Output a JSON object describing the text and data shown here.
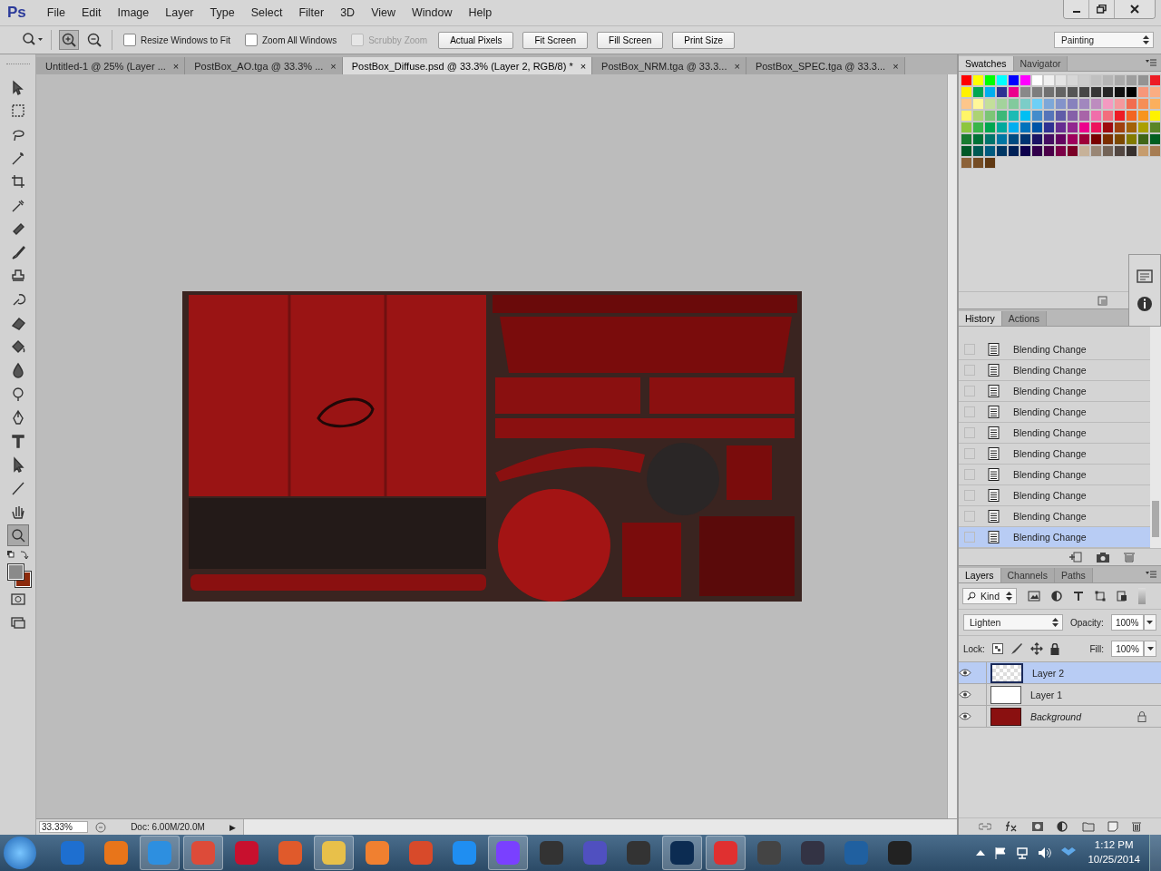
{
  "app": {
    "logo": "Ps"
  },
  "menu": [
    "File",
    "Edit",
    "Image",
    "Layer",
    "Type",
    "Select",
    "Filter",
    "3D",
    "View",
    "Window",
    "Help"
  ],
  "options": {
    "zoom_buttons": [
      {
        "kind": "in",
        "selected": true
      },
      {
        "kind": "out",
        "selected": false
      }
    ],
    "checkboxes": [
      {
        "label": "Resize Windows to Fit",
        "checked": false,
        "disabled": false
      },
      {
        "label": "Zoom All Windows",
        "checked": false,
        "disabled": false
      },
      {
        "label": "Scrubby Zoom",
        "checked": false,
        "disabled": true
      }
    ],
    "buttons": [
      "Actual Pixels",
      "Fit Screen",
      "Fill Screen",
      "Print Size"
    ],
    "workspace": "Painting"
  },
  "tabs": [
    {
      "label": "Untitled-1 @ 25% (Layer ...",
      "close": "×",
      "selected": false
    },
    {
      "label": "PostBox_AO.tga @ 33.3% ...",
      "close": "×",
      "selected": false
    },
    {
      "label": "PostBox_Diffuse.psd @ 33.3% (Layer 2, RGB/8) *",
      "close": "×",
      "selected": true
    },
    {
      "label": "PostBox_NRM.tga @ 33.3...",
      "close": "×",
      "selected": false
    },
    {
      "label": "PostBox_SPEC.tga @ 33.3...",
      "close": "×",
      "selected": false
    }
  ],
  "tools": [
    {
      "kind": "move",
      "selected": false
    },
    {
      "kind": "marquee",
      "selected": false
    },
    {
      "kind": "lasso",
      "selected": false
    },
    {
      "kind": "wand",
      "selected": false
    },
    {
      "kind": "crop",
      "selected": false
    },
    {
      "kind": "eyedropper",
      "selected": false
    },
    {
      "kind": "heal",
      "selected": false
    },
    {
      "kind": "brush",
      "selected": false
    },
    {
      "kind": "stamp",
      "selected": false
    },
    {
      "kind": "history",
      "selected": false
    },
    {
      "kind": "eraser",
      "selected": false
    },
    {
      "kind": "bucket",
      "selected": false
    },
    {
      "kind": "blur",
      "selected": false
    },
    {
      "kind": "dodge",
      "selected": false
    },
    {
      "kind": "pen",
      "selected": false
    },
    {
      "kind": "type",
      "selected": false
    },
    {
      "kind": "select",
      "selected": false
    },
    {
      "kind": "line",
      "selected": false
    },
    {
      "kind": "hand",
      "selected": false
    },
    {
      "kind": "zoom",
      "selected": true
    }
  ],
  "colors": [
    {
      "kind": "foreground",
      "color": "#8a8a8a"
    },
    {
      "kind": "background",
      "color": "#8c2a0c"
    }
  ],
  "status": {
    "zoom": "33.33%",
    "doc": "Doc: 6.00M/20.0M",
    "arrow": "▶"
  },
  "swatches_panel": {
    "tabs": [
      {
        "label": "Swatches",
        "selected": true
      },
      {
        "label": "Navigator",
        "selected": false
      }
    ],
    "rows": [
      [
        {
          "color": "#ff0000"
        },
        {
          "color": "#ffff00"
        },
        {
          "color": "#00ff00"
        },
        {
          "color": "#00ffff"
        },
        {
          "color": "#0000ff"
        },
        {
          "color": "#ff00ff"
        },
        {
          "color": "#ffffff"
        },
        {
          "color": "#f0f0f0"
        },
        {
          "color": "#e3e3e3"
        },
        {
          "color": "#d6d6d6"
        },
        {
          "color": "#cccccc"
        },
        {
          "color": "#c0c0c0"
        },
        {
          "color": "#b5b5b5"
        },
        {
          "color": "#a9a9a9"
        },
        {
          "color": "#9e9e9e"
        },
        {
          "color": "#939393"
        },
        {
          "color": "#ed1c24"
        }
      ],
      [
        {
          "color": "#fff200"
        },
        {
          "color": "#00a651"
        },
        {
          "color": "#00aeef"
        },
        {
          "color": "#2e3192"
        },
        {
          "color": "#ec008c"
        },
        {
          "color": "#898989"
        },
        {
          "color": "#7d7d7d"
        },
        {
          "color": "#707070"
        },
        {
          "color": "#636363"
        },
        {
          "color": "#555555"
        },
        {
          "color": "#464646"
        },
        {
          "color": "#363636"
        },
        {
          "color": "#262626"
        },
        {
          "color": "#111111"
        },
        {
          "color": "#000000"
        },
        {
          "color": "#f7977a"
        },
        {
          "color": "#fbad82"
        }
      ],
      [
        {
          "color": "#fdc68a"
        },
        {
          "color": "#fff799"
        },
        {
          "color": "#c4df9b"
        },
        {
          "color": "#a3d39c"
        },
        {
          "color": "#82ca9d"
        },
        {
          "color": "#7bcdc8"
        },
        {
          "color": "#6dcff6"
        },
        {
          "color": "#7da7d8"
        },
        {
          "color": "#8393ca"
        },
        {
          "color": "#8781bd"
        },
        {
          "color": "#a187be"
        },
        {
          "color": "#bd8cbf"
        },
        {
          "color": "#f49ac1"
        },
        {
          "color": "#f5989d"
        },
        {
          "color": "#f26c4f"
        },
        {
          "color": "#f68e56"
        },
        {
          "color": "#fbaf5d"
        }
      ],
      [
        {
          "color": "#fff568"
        },
        {
          "color": "#acd373"
        },
        {
          "color": "#7cc576"
        },
        {
          "color": "#3cb878"
        },
        {
          "color": "#1cbbb4"
        },
        {
          "color": "#00bff3"
        },
        {
          "color": "#448ccb"
        },
        {
          "color": "#5574b9"
        },
        {
          "color": "#605ca8"
        },
        {
          "color": "#8560a8"
        },
        {
          "color": "#a864a8"
        },
        {
          "color": "#f06eaa"
        },
        {
          "color": "#f26d7d"
        },
        {
          "color": "#ed1c24"
        },
        {
          "color": "#f26522"
        },
        {
          "color": "#f7941d"
        },
        {
          "color": "#fff200"
        }
      ],
      [
        {
          "color": "#8dc63f"
        },
        {
          "color": "#39b54a"
        },
        {
          "color": "#00a651"
        },
        {
          "color": "#00a99d"
        },
        {
          "color": "#00aeef"
        },
        {
          "color": "#0072bc"
        },
        {
          "color": "#0054a6"
        },
        {
          "color": "#2e3192"
        },
        {
          "color": "#662d91"
        },
        {
          "color": "#92278f"
        },
        {
          "color": "#ec008c"
        },
        {
          "color": "#ed145b"
        },
        {
          "color": "#9e0b0f"
        },
        {
          "color": "#a0410d"
        },
        {
          "color": "#a36209"
        },
        {
          "color": "#aba000"
        },
        {
          "color": "#598527"
        }
      ],
      [
        {
          "color": "#197b30"
        },
        {
          "color": "#007236"
        },
        {
          "color": "#00746b"
        },
        {
          "color": "#0076a3"
        },
        {
          "color": "#004b80"
        },
        {
          "color": "#003471"
        },
        {
          "color": "#1b1464"
        },
        {
          "color": "#440e62"
        },
        {
          "color": "#630460"
        },
        {
          "color": "#9e005d"
        },
        {
          "color": "#9e0039"
        },
        {
          "color": "#790000"
        },
        {
          "color": "#7b2e00"
        },
        {
          "color": "#7d4900"
        },
        {
          "color": "#827b00"
        },
        {
          "color": "#406618"
        },
        {
          "color": "#005e20"
        }
      ],
      [
        {
          "color": "#005826"
        },
        {
          "color": "#005952"
        },
        {
          "color": "#005b7f"
        },
        {
          "color": "#003663"
        },
        {
          "color": "#002157"
        },
        {
          "color": "#0d004c"
        },
        {
          "color": "#32004b"
        },
        {
          "color": "#4b0049"
        },
        {
          "color": "#7b0046"
        },
        {
          "color": "#7a0026"
        },
        {
          "color": "#c7b299"
        },
        {
          "color": "#998675"
        },
        {
          "color": "#736357"
        },
        {
          "color": "#534741"
        },
        {
          "color": "#37302d"
        },
        {
          "color": "#c69c6d"
        },
        {
          "color": "#a67c52"
        }
      ],
      [
        {
          "color": "#8c6239"
        },
        {
          "color": "#754c24"
        },
        {
          "color": "#603913"
        }
      ]
    ]
  },
  "history_panel": {
    "tabs": [
      {
        "label": "History",
        "selected": true
      },
      {
        "label": "Actions",
        "selected": false
      }
    ],
    "items": [
      {
        "label": "Blending Change",
        "selected": false
      },
      {
        "label": "Blending Change",
        "selected": false
      },
      {
        "label": "Blending Change",
        "selected": false
      },
      {
        "label": "Blending Change",
        "selected": false
      },
      {
        "label": "Blending Change",
        "selected": false
      },
      {
        "label": "Blending Change",
        "selected": false
      },
      {
        "label": "Blending Change",
        "selected": false
      },
      {
        "label": "Blending Change",
        "selected": false
      },
      {
        "label": "Blending Change",
        "selected": false
      },
      {
        "label": "Blending Change",
        "selected": true
      }
    ]
  },
  "layers_panel": {
    "tabs": [
      {
        "label": "Layers",
        "selected": true
      },
      {
        "label": "Channels",
        "selected": false
      },
      {
        "label": "Paths",
        "selected": false
      }
    ],
    "filter": "Kind",
    "blend_mode": "Lighten",
    "opacity_label": "Opacity:",
    "opacity": "100%",
    "lock_label": "Lock:",
    "fill_label": "Fill:",
    "fill": "100%",
    "layers": [
      {
        "name": "Layer 2",
        "kind": "transparent",
        "visible": true,
        "selected": true,
        "locked": false,
        "italic": false
      },
      {
        "name": "Layer 1",
        "kind": "white",
        "visible": true,
        "selected": false,
        "locked": false,
        "italic": false
      },
      {
        "name": "Background",
        "kind": "texture",
        "visible": true,
        "selected": false,
        "locked": true,
        "italic": true
      }
    ]
  },
  "clock": {
    "time": "1:12 PM",
    "date": "10/25/2014"
  }
}
